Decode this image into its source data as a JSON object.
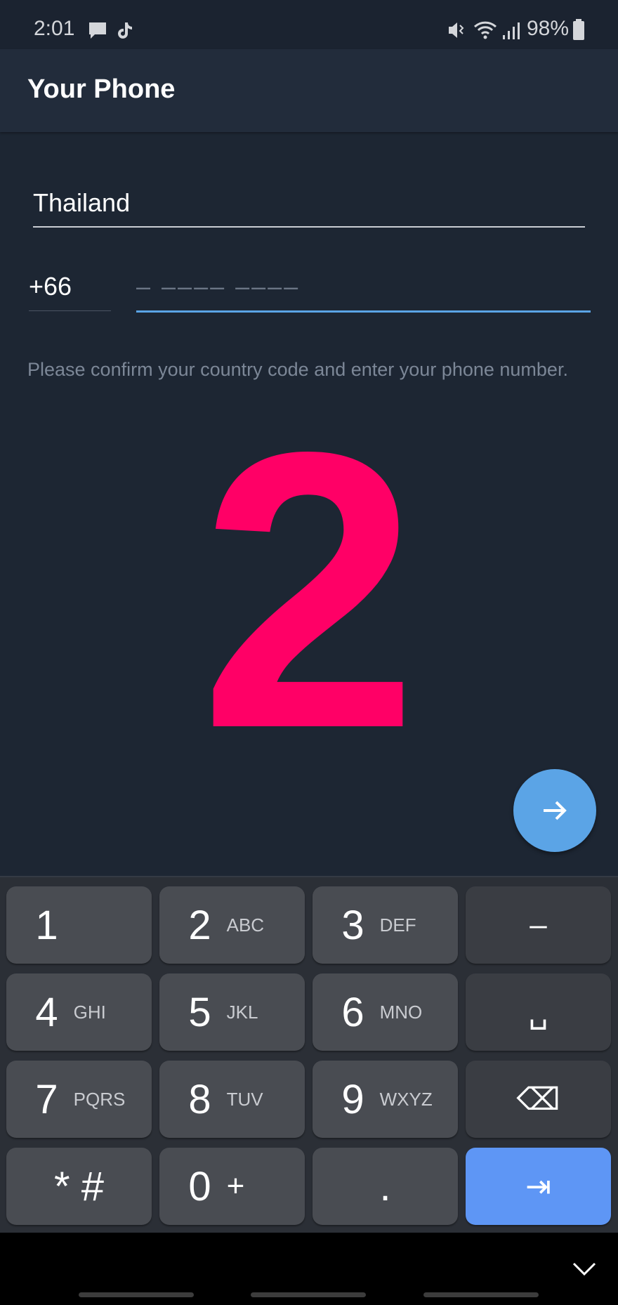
{
  "status_bar": {
    "time": "2:01",
    "battery": "98%",
    "icons": [
      "message-icon",
      "tiktok-icon",
      "mute-icon",
      "wifi-icon",
      "signal-icon",
      "battery-icon"
    ]
  },
  "app_bar": {
    "title": "Your Phone"
  },
  "form": {
    "country": "Thailand",
    "country_code": "+66",
    "phone_placeholder": "– –––– ––––",
    "hint": "Please confirm your country code and enter your phone number."
  },
  "overlay": {
    "label": "2",
    "color": "#FF0066"
  },
  "fab": {
    "icon": "arrow-right-icon",
    "color": "#5BA4E6"
  },
  "keyboard": {
    "keys": [
      {
        "num": "1",
        "letters": ""
      },
      {
        "num": "2",
        "letters": "ABC"
      },
      {
        "num": "3",
        "letters": "DEF"
      },
      {
        "num": "–",
        "letters": "",
        "fn": true
      },
      {
        "num": "4",
        "letters": "GHI"
      },
      {
        "num": "5",
        "letters": "JKL"
      },
      {
        "num": "6",
        "letters": "MNO"
      },
      {
        "num": "␣",
        "letters": "",
        "fn": true,
        "icon": "space-icon"
      },
      {
        "num": "7",
        "letters": "PQRS"
      },
      {
        "num": "8",
        "letters": "TUV"
      },
      {
        "num": "9",
        "letters": "WXYZ"
      },
      {
        "num": "⌫",
        "letters": "",
        "fn": true,
        "icon": "backspace-icon"
      },
      {
        "num": "* #",
        "letters": ""
      },
      {
        "num": "0",
        "letters": "+"
      },
      {
        "num": ".",
        "letters": ""
      },
      {
        "num": "⇥",
        "letters": "",
        "go": true,
        "icon": "next-field-icon"
      }
    ],
    "accent": "#5E96F5"
  }
}
